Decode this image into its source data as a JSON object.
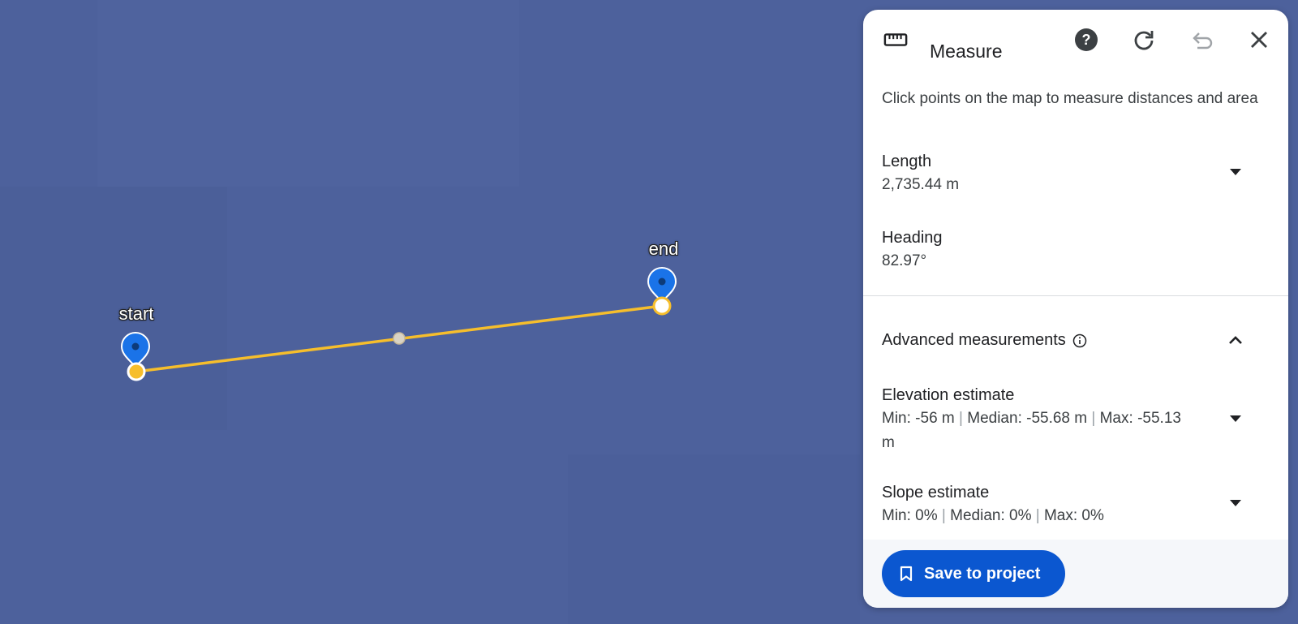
{
  "map": {
    "start_label": "start",
    "end_label": "end",
    "line_color": "#f6be2c",
    "pin_color": "#1a73e8"
  },
  "panel": {
    "title": "Measure",
    "description": "Click points on the map to measure distances and area",
    "length": {
      "label": "Length",
      "value": "2,735.44 m"
    },
    "heading": {
      "label": "Heading",
      "value": "82.97°"
    },
    "advanced": {
      "label": "Advanced measurements"
    },
    "elevation": {
      "label": "Elevation estimate",
      "min": "Min: -56 m",
      "median": "Median: -55.68 m",
      "max_label": "Max:",
      "max_value": "-55.13 m",
      "separator": "|"
    },
    "slope": {
      "label": "Slope estimate",
      "min": "Min: 0%",
      "median": "Median: 0%",
      "max": "Max: 0%",
      "separator": "|"
    },
    "save_label": "Save to project"
  },
  "icons": [
    "ruler-icon",
    "help-icon",
    "refresh-icon",
    "undo-icon",
    "close-icon",
    "chevron-down-icon",
    "chevron-up-icon",
    "info-icon",
    "bookmark-icon"
  ],
  "colors": {
    "map_bg": "#4d619c",
    "accent": "#0b57d0"
  }
}
